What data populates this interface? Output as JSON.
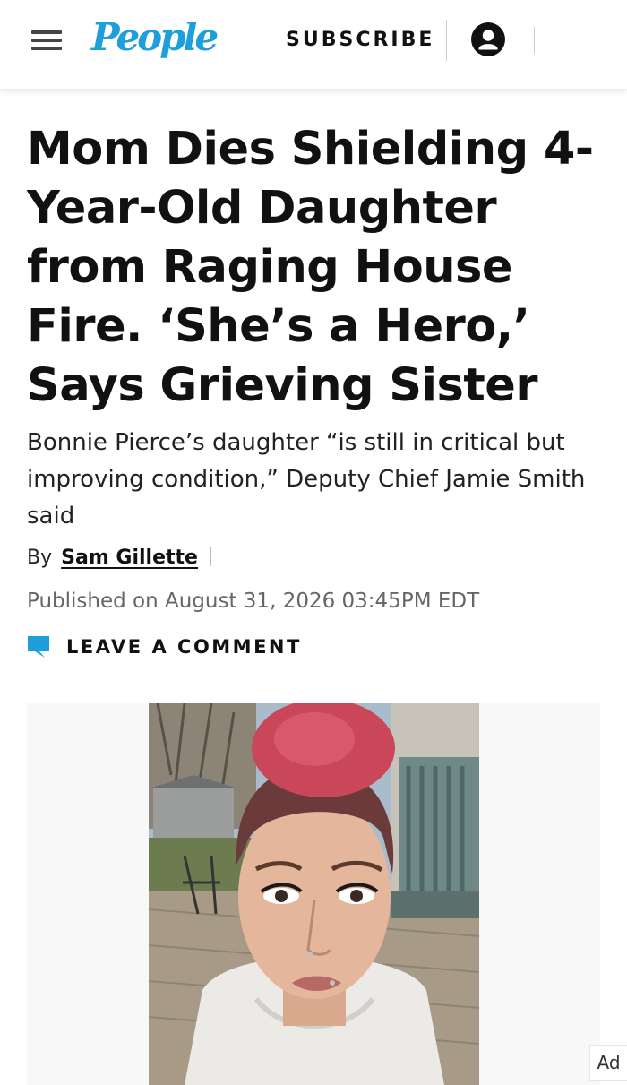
{
  "header": {
    "logo_text": "People",
    "subscribe_label": "SUBSCRIBE",
    "menu_icon": "hamburger-menu-icon",
    "account_icon": "account-circle-icon"
  },
  "article": {
    "headline": "Mom Dies Shielding 4-Year-Old Daughter from Raging House Fire. ‘She’s a Hero,’ Says Grieving Sister",
    "dek": "Bonnie Pierce’s daughter “is still in critical but improving condition,” Deputy Chief Jamie Smith said",
    "byline_prefix": "By",
    "author": "Sam Gillette",
    "published": "Published on August 31, 2026 03:45PM EDT",
    "comment_label": "LEAVE A COMMENT",
    "comment_icon": "speech-bubble-icon"
  },
  "ad": {
    "label": "Ad"
  },
  "colors": {
    "brand": "#1e9fd9",
    "text": "#111111",
    "muted": "#666666"
  }
}
